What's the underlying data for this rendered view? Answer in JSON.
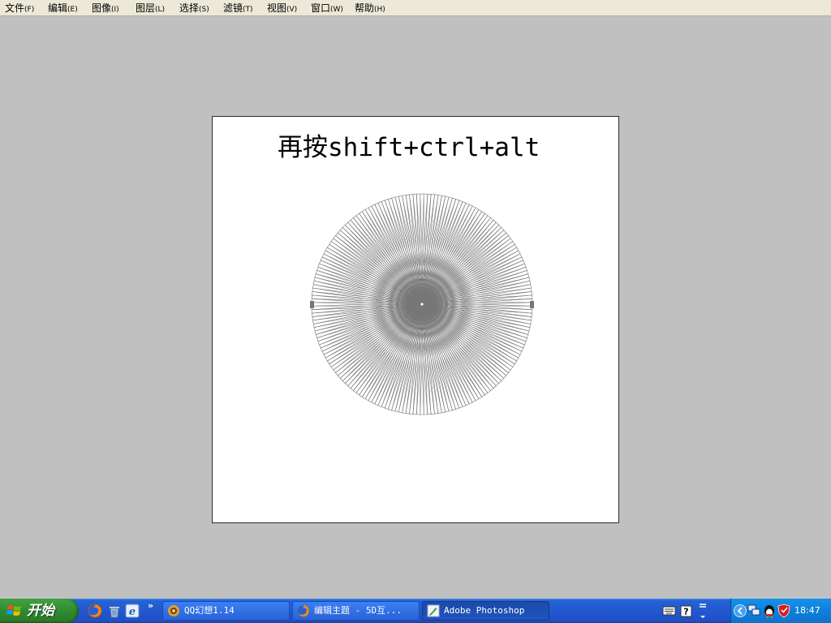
{
  "menubar": {
    "items": [
      {
        "label": "文件",
        "mnemonic": "(F)"
      },
      {
        "label": "编辑",
        "mnemonic": "(E)"
      },
      {
        "label": "图像",
        "mnemonic": "(I)"
      },
      {
        "label": "图层",
        "mnemonic": "(L)"
      },
      {
        "label": "选择",
        "mnemonic": "(S)"
      },
      {
        "label": "滤镜",
        "mnemonic": "(T)"
      },
      {
        "label": "视图",
        "mnemonic": "(V)"
      },
      {
        "label": "窗口",
        "mnemonic": "(W)"
      },
      {
        "label": "帮助",
        "mnemonic": "(H)"
      }
    ]
  },
  "canvas": {
    "caption": "再按shift+ctrl+alt",
    "background_color": "#ffffff",
    "stroke_color": "#777777"
  },
  "desktop": {
    "background_color": "#c0c0c0"
  },
  "taskbar": {
    "start_label": "开始",
    "quicklaunch_icons": [
      "firefox-icon",
      "recycle-bin-icon",
      "ie-icon"
    ],
    "tasks": [
      {
        "label": "QQ幻想1.14",
        "icon": "qq-game-icon",
        "active": false
      },
      {
        "label": "编辑主题 - 5D互...",
        "icon": "firefox-icon",
        "active": false
      },
      {
        "label": "Adobe Photoshop",
        "icon": "photoshop-icon",
        "active": true
      }
    ],
    "tray_icons": [
      "keyboard-icon",
      "help-icon",
      "language-options-icon",
      "tray-expand-icon",
      "network-icon",
      "qq-icon",
      "security-shield-icon"
    ],
    "clock": "18:47"
  }
}
